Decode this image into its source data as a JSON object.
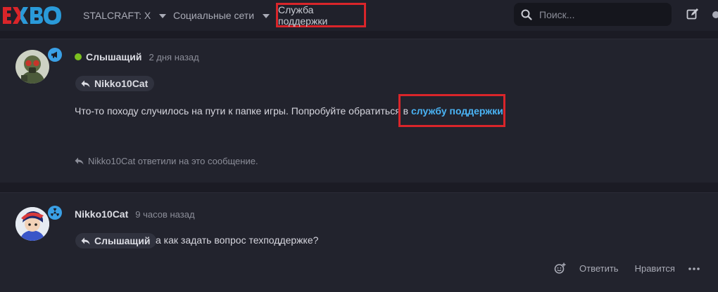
{
  "header": {
    "logo_text": "EXBO",
    "nav": [
      {
        "label": "STALCRAFT: X",
        "has_dropdown": true
      },
      {
        "label": "Социальные сети",
        "has_dropdown": true
      },
      {
        "label": "Служба поддержки",
        "has_dropdown": false,
        "highlighted": true
      }
    ],
    "search_placeholder": "Поиск...",
    "icons": [
      "search-icon",
      "edit-icon"
    ]
  },
  "posts": [
    {
      "author": "Слышащий",
      "online": true,
      "time": "2 дня назад",
      "badge_icon": "megaphone-icon",
      "reply_to": "Nikko10Cat",
      "message_before_link": "Что-то походу случилось на пути к папке игры. Попробуйте обратиться в ",
      "link_text": "службу поддержки",
      "message_after_link": ".",
      "replies_note": "Nikko10Cat ответили на это сообщение."
    },
    {
      "author": "Nikko10Cat",
      "online": false,
      "time": "9 часов назад",
      "badge_icon": "radiation-icon",
      "reply_to": "Слышащий",
      "message": "а как задать вопрос техподдержке?",
      "actions": {
        "reply": "Ответить",
        "like": "Нравится"
      }
    }
  ],
  "colors": {
    "accent_red": "#d9252a",
    "link_blue": "#4ab3f4",
    "online_green": "#7cc020",
    "badge_blue": "#3aa0e6"
  }
}
